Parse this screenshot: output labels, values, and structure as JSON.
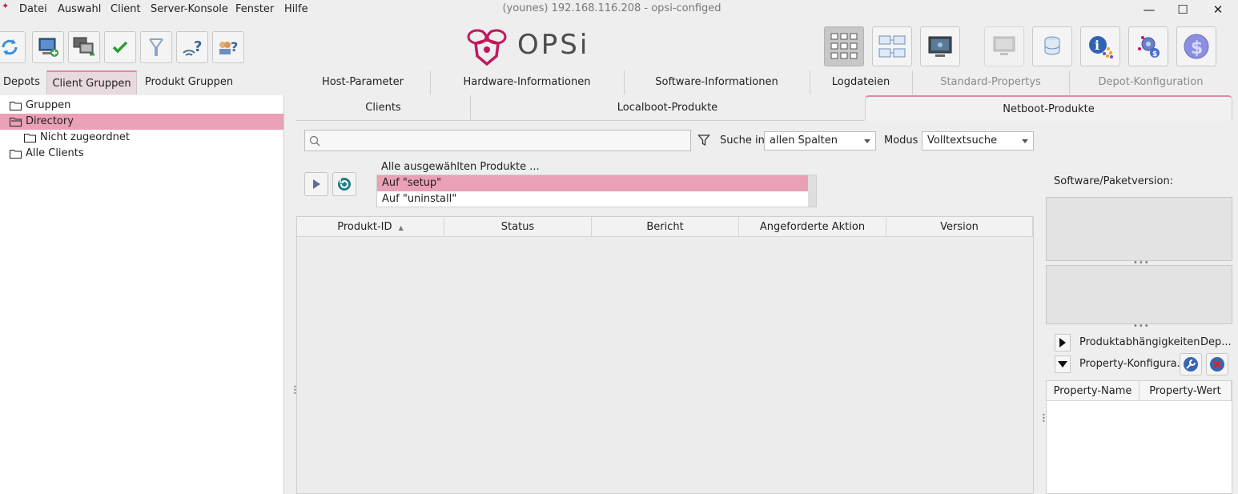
{
  "window": {
    "title": "(younes) 192.168.116.208 - opsi-configed",
    "minimize": "—",
    "maximize": "☐",
    "close": "✕"
  },
  "menu": [
    "Datei",
    "Auswahl",
    "Client",
    "Server-Konsole",
    "Fenster",
    "Hilfe"
  ],
  "logo": {
    "text": "OPSi",
    "color": "#c2185b"
  },
  "toolbar_left": [
    {
      "name": "reload-icon"
    },
    {
      "name": "new-client-icon"
    },
    {
      "name": "multi-client-icon"
    },
    {
      "name": "checkmark-icon"
    },
    {
      "name": "filter-icon"
    },
    {
      "name": "network-query-icon"
    },
    {
      "name": "help-group-icon"
    }
  ],
  "toolbar_right": [
    {
      "name": "client-grid-icon",
      "pressed": true
    },
    {
      "name": "client-list-icon"
    },
    {
      "name": "server-console-icon"
    },
    {
      "name": "depot-monitor-icon",
      "disabled": true
    },
    {
      "name": "database-icon"
    },
    {
      "name": "info-icon"
    },
    {
      "name": "license-icon"
    },
    {
      "name": "dollar-icon"
    }
  ],
  "left_tabs": [
    "Depots",
    "Client Gruppen",
    "Produkt Gruppen"
  ],
  "tree": [
    {
      "label": "Gruppen",
      "depth": 0
    },
    {
      "label": "Directory",
      "depth": 0,
      "selected": true
    },
    {
      "label": "Nicht zugeordnet",
      "depth": 1
    },
    {
      "label": "Alle Clients",
      "depth": 0
    }
  ],
  "main_tabs": [
    "Host-Parameter",
    "Hardware-Informationen",
    "Software-Informationen",
    "Logdateien",
    "Standard-Propertys",
    "Depot-Konfiguration"
  ],
  "sub_tabs": [
    "Clients",
    "Localboot-Produkte",
    "Netboot-Produkte"
  ],
  "search": {
    "placeholder": "",
    "search_in_label": "Suche in",
    "search_in_value": "allen Spalten",
    "mode_label": "Modus",
    "mode_value": "Volltextsuche"
  },
  "actions": {
    "header": "Alle ausgewählten Produkte ...",
    "items": [
      "Auf \"setup\"",
      "Auf \"uninstall\""
    ]
  },
  "table": {
    "columns": [
      "Produkt-ID",
      "Status",
      "Bericht",
      "Angeforderte Aktion",
      "Version"
    ],
    "sort_indicator": "▲"
  },
  "right_panel": {
    "version_label": "Software/Paketversion:",
    "dependencies_label": "Produktabhängigkeiten",
    "dependencies_extra": "Dep...",
    "property_label": "Property-Konfigura...",
    "property_columns": [
      "Property-Name",
      "Property-Wert"
    ]
  },
  "colors": {
    "accent": "#e08aa3",
    "selection": "#eaa0b5"
  }
}
